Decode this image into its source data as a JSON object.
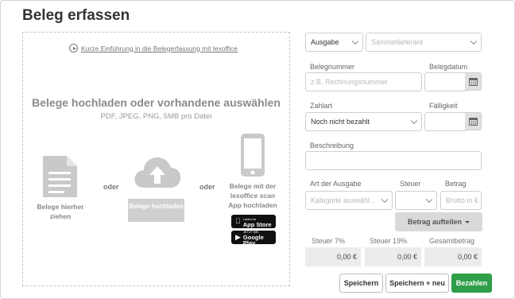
{
  "title": "Beleg erfassen",
  "upload": {
    "intro_link": "Kurze Einführung in die Belegerfassung mit lexoffice",
    "heading": "Belege hochladen oder vorhandene auswählen",
    "formats": "PDF, JPEG, PNG, 5MB pro Datei",
    "drag_label": "Belege hierher ziehen",
    "or1": "oder",
    "upload_button": "Belege hochladen",
    "or2": "oder",
    "app_label": "Belege mit der lexoffice scan App hochladen",
    "app_store": {
      "small": "Laden im",
      "big": "App Store"
    },
    "google_play": {
      "small": "JETZT BEI",
      "big": "Google Play"
    }
  },
  "form": {
    "type_select": "Ausgabe",
    "vendor_placeholder": "Sammellieferant",
    "belegnummer_label": "Belegnummer",
    "belegnummer_placeholder": "z.B. Rechnungsnummer",
    "belegdatum_label": "Belegdatum",
    "zahlart_label": "Zahlart",
    "zahlart_value": "Noch nicht bezahlt",
    "faelligkeit_label": "Fälligkeit",
    "beschreibung_label": "Beschreibung",
    "art_label": "Art der Ausgabe",
    "art_placeholder": "Kategorie auswähl...",
    "steuer_label": "Steuer",
    "betrag_label": "Betrag",
    "betrag_placeholder": "Brutto in €",
    "split_button": "Betrag aufteilen",
    "steuer7_label": "Steuer 7%",
    "steuer7_value": "0,00 €",
    "steuer19_label": "Steuer 19%",
    "steuer19_value": "0,00 €",
    "gesamt_label": "Gesamtbetrag",
    "gesamt_value": "0,00 €"
  },
  "actions": {
    "save": "Speichern",
    "save_new": "Speichern + neu",
    "pay": "Bezahlen"
  },
  "colors": {
    "primary": "#2e9e48",
    "muted": "#d0d0d0"
  }
}
